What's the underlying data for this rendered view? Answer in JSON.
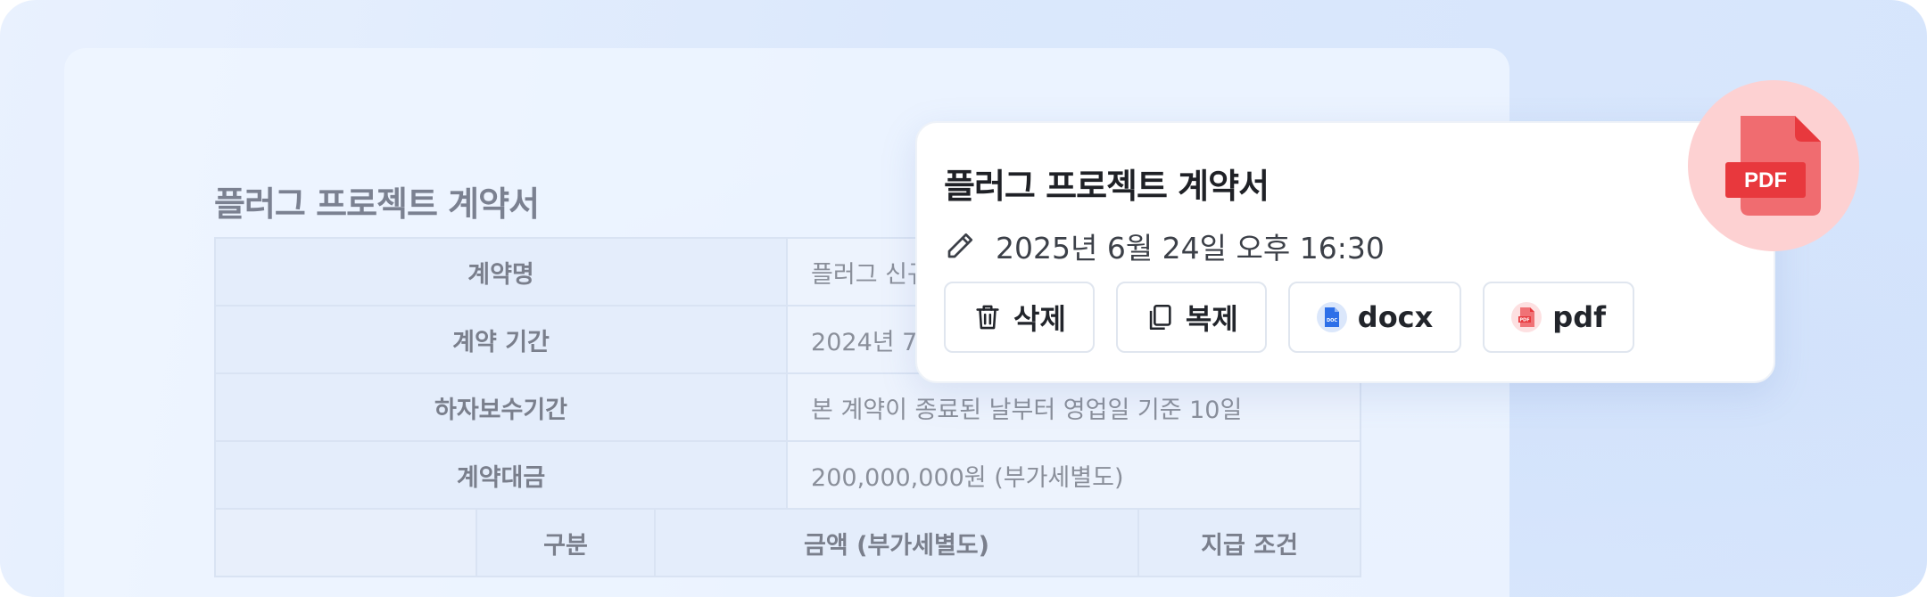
{
  "document": {
    "title": "플러그 프로젝트 계약서",
    "rows": [
      {
        "label": "계약명",
        "value": "플러그 신규"
      },
      {
        "label": "계약 기간",
        "value": "2024년 7"
      },
      {
        "label": "하자보수기간",
        "value": "본 계약이 종료된 날부터 영업일 기준 10일"
      },
      {
        "label": "계약대금",
        "value": "200,000,000원 (부가세별도)"
      }
    ],
    "payment_headers": [
      "구분",
      "금액 (부가세별도)",
      "지급 조건"
    ]
  },
  "card": {
    "title": "플러그 프로젝트 계약서",
    "timestamp": "2025년 6월 24일 오후 16:30",
    "actions": {
      "delete": "삭제",
      "duplicate": "복제",
      "docx": "docx",
      "pdf": "pdf"
    }
  },
  "pdf_badge_label": "PDF",
  "docx_icon_label": "DOC",
  "colors": {
    "pdf_red": "#e8383d",
    "docx_blue": "#2d6fe8",
    "badge_bg": "#fdd1d2"
  }
}
